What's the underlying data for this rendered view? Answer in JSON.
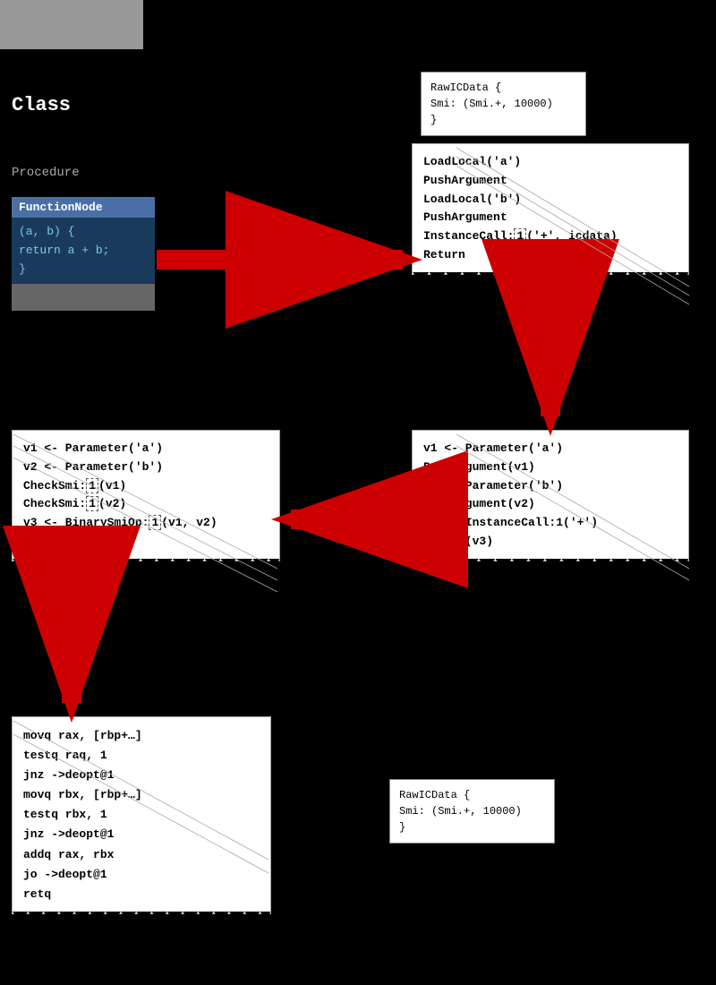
{
  "class_label": "Class",
  "procedure_label": "Procedure",
  "function_node": {
    "header": "FunctionNode",
    "body_line1": "(a, b) {",
    "body_line2": "  return a + b;",
    "body_line3": "}"
  },
  "raw_ic_top": {
    "line1": "RawICData {",
    "line2": "  Smi: (Smi.+, 10000)",
    "line3": "}"
  },
  "bytecode": {
    "line1": "LoadLocal('a')",
    "line2": "PushArgument",
    "line3": "LoadLocal('b')",
    "line4": "PushArgument",
    "line5_pre": "InstanceCall:",
    "line5_ic": "1",
    "line5_args": "('+', icdata)",
    "line6": "Return"
  },
  "hir_right": {
    "line1": "v1 <- Parameter('a')",
    "line2": "PushArgument(v1)",
    "line3": "v2 <- Parameter('b')",
    "line4": "PushArgument(v2)",
    "line5": "v3 <- InstanceCall:1('+')",
    "line6": "Return(v3)"
  },
  "hir_left": {
    "line1": "v1 <- Parameter('a')",
    "line2": "v2 <- Parameter('b')",
    "line3_pre": "CheckSmi:",
    "line3_ic": "1",
    "line3_arg": "(v1)",
    "line4_pre": "CheckSmi:",
    "line4_ic": "1",
    "line4_arg": "(v2)",
    "line5_pre": "v3 <- BinarySmiOp:",
    "line5_ic": "1",
    "line5_args": "(v1, v2)",
    "line6": "Return(v3)"
  },
  "machine_code": {
    "line1": "movq rax, [rbp+…]",
    "line2": "testq raq, 1",
    "line3": "jnz ->deopt@1",
    "line4": "movq rbx, [rbp+…]",
    "line5": "testq rbx, 1",
    "line6": "jnz ->deopt@1",
    "line7": "addq rax, rbx",
    "line8": "jo ->deopt@1",
    "line9": "retq"
  },
  "raw_ic_bottom": {
    "line1": "RawICData {",
    "line2": "  Smi: (Smi.+, 10000)",
    "line3": "}"
  }
}
